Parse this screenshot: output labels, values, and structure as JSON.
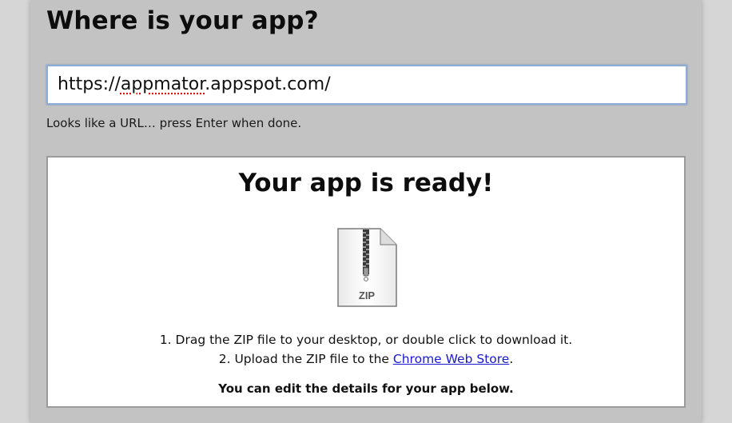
{
  "section": {
    "heading": "Where is your app?"
  },
  "url_field": {
    "value_prefix": "https://",
    "value_misspelled": "appmator",
    "value_suffix": ".appspot.com/",
    "hint": "Looks like a URL… press Enter when done."
  },
  "result": {
    "title": "Your app is ready!",
    "file_label": "ZIP",
    "step1": "1. Drag the ZIP file to your desktop, or double click to download it.",
    "step2_prefix": "2. Upload the ZIP file to the ",
    "step2_link": "Chrome Web Store",
    "step2_suffix": ".",
    "edit_note": "You can edit the details for your app below."
  },
  "colors": {
    "panel_background": "#c3c3c3",
    "link": "#1a1acc",
    "input_focus_border": "#8aaed8"
  },
  "icons": {
    "zip_file": "zip-file-icon"
  }
}
